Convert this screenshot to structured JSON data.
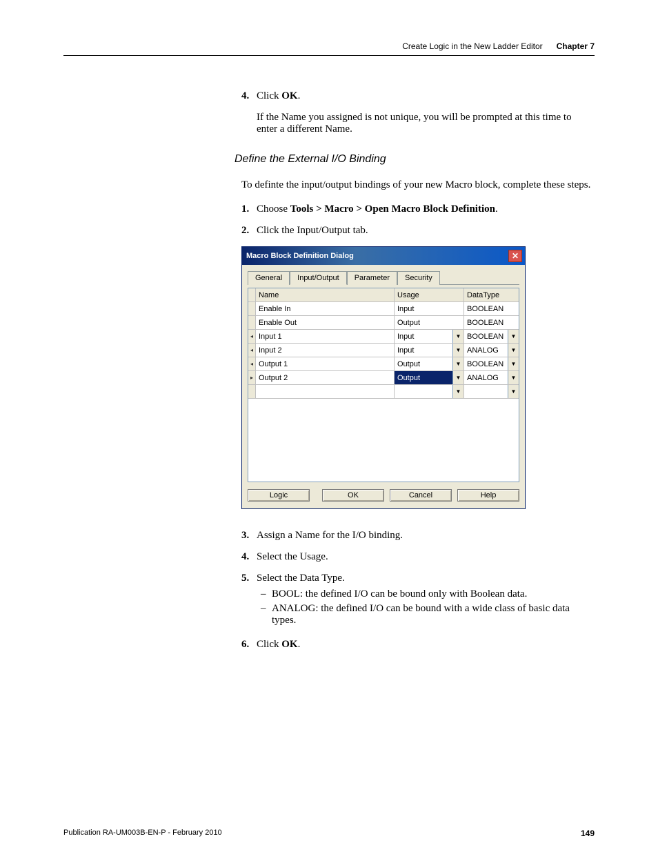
{
  "header": {
    "section": "Create Logic in the New Ladder Editor",
    "chapter": "Chapter 7"
  },
  "pre_steps": [
    {
      "num": "4.",
      "text_prefix": "Click ",
      "bold": "OK",
      "text_suffix": "."
    }
  ],
  "pre_note": "If the Name you assigned is not unique, you will be prompted at this time to enter a different Name.",
  "section_heading": "Define the External I/O Binding",
  "intro_para": "To definte the input/output bindings of your new Macro block, complete these steps.",
  "steps": [
    {
      "num": "1.",
      "text_prefix": "Choose ",
      "bold": "Tools > Macro > Open Macro Block Definition",
      "text_suffix": "."
    },
    {
      "num": "2.",
      "text_prefix": "Click the Input/Output tab.",
      "bold": "",
      "text_suffix": ""
    }
  ],
  "dialog": {
    "title": "Macro Block Definition Dialog",
    "tabs": [
      "General",
      "Input/Output",
      "Parameter",
      "Security"
    ],
    "active_tab_index": 1,
    "columns": {
      "name": "Name",
      "usage": "Usage",
      "datatype": "DataType"
    },
    "rows": [
      {
        "marker": "",
        "name": "Enable In",
        "usage": "Input",
        "usage_dd": false,
        "datatype": "BOOLEAN",
        "type_dd": false,
        "sel": false
      },
      {
        "marker": "",
        "name": "Enable Out",
        "usage": "Output",
        "usage_dd": false,
        "datatype": "BOOLEAN",
        "type_dd": false,
        "sel": false
      },
      {
        "marker": "◂",
        "name": "Input 1",
        "usage": "Input",
        "usage_dd": true,
        "datatype": "BOOLEAN",
        "type_dd": true,
        "sel": false
      },
      {
        "marker": "◂",
        "name": "Input 2",
        "usage": "Input",
        "usage_dd": true,
        "datatype": "ANALOG",
        "type_dd": true,
        "sel": false
      },
      {
        "marker": "◂",
        "name": "Output 1",
        "usage": "Output",
        "usage_dd": true,
        "datatype": "BOOLEAN",
        "type_dd": true,
        "sel": false
      },
      {
        "marker": "▸",
        "name": "Output 2",
        "usage": "Output",
        "usage_dd": true,
        "datatype": "ANALOG",
        "type_dd": true,
        "sel": true
      },
      {
        "marker": "",
        "name": "",
        "usage": "",
        "usage_dd": true,
        "datatype": "",
        "type_dd": true,
        "sel": false
      }
    ],
    "buttons": {
      "logic": "Logic",
      "ok": "OK",
      "cancel": "Cancel",
      "help": "Help"
    }
  },
  "post_steps": [
    {
      "num": "3.",
      "text": "Assign a Name for the I/O binding."
    },
    {
      "num": "4.",
      "text": "Select the Usage."
    },
    {
      "num": "5.",
      "text": "Select the Data Type.",
      "bullets": [
        "BOOL: the defined I/O can be bound only with Boolean data.",
        "ANALOG: the defined I/O can be bound with a wide class of basic data types."
      ]
    },
    {
      "num": "6.",
      "text_prefix": "Click ",
      "bold": "OK",
      "text_suffix": "."
    }
  ],
  "footer": {
    "pub": "Publication RA-UM003B-EN-P - February 2010",
    "page": "149"
  }
}
